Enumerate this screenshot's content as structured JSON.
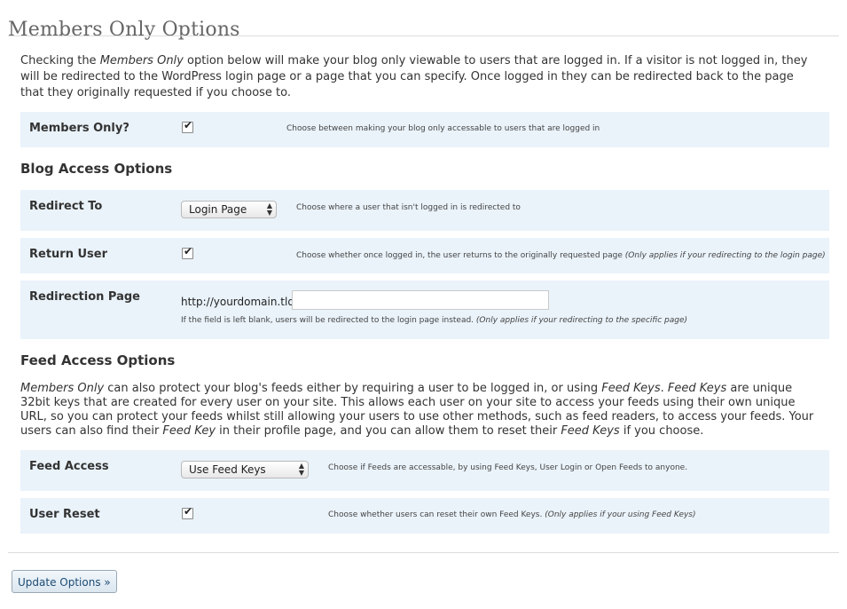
{
  "page": {
    "title": "Members Only Options",
    "intro_text_1": "Checking the ",
    "intro_em": "Members Only",
    "intro_text_2": " option below will make your blog only viewable to users that are logged in. If a visitor is not logged in, they will be redirected to the WordPress login page or a page that you can specify. Once logged in they can be redirected back to the page that they originally requested if you choose to."
  },
  "members_only": {
    "label": "Members Only?",
    "checked": true,
    "desc": "Choose between making your blog only accessable to users that are logged in"
  },
  "blog_access": {
    "heading": "Blog Access Options",
    "redirect_to": {
      "label": "Redirect To",
      "selected": "Login Page",
      "desc": "Choose where a user that isn't logged in is redirected to"
    },
    "return_user": {
      "label": "Return User",
      "checked": true,
      "desc": "Choose whether once logged in, the user returns to the originally requested page ",
      "note": "(Only applies if your redirecting to the login page)"
    },
    "redirection_page": {
      "label": "Redirection Page",
      "prefix": "http://yourdomain.tld/",
      "value": "",
      "desc": "If the field is left blank, users will be redirected to the login page instead. ",
      "note": "(Only applies if your redirecting to the specific page)"
    }
  },
  "feed_access": {
    "heading": "Feed Access Options",
    "text_em1": "Members Only",
    "text_1": " can also protect your blog's feeds either by requiring a user to be logged in, or using ",
    "text_em2": "Feed Keys",
    "text_2": ". ",
    "text_em3": "Feed Keys",
    "text_3": " are unique 32bit keys that are created for every user on your site. This allows each user on your site to access your feeds using their own unique URL, so you can protect your feeds whilst still allowing your users to use other methods, such as feed readers, to access your feeds. Your users can also find their ",
    "text_em4": "Feed Key",
    "text_4": " in their profile page, and you can allow them to reset their ",
    "text_em5": "Feed Keys",
    "text_5": " if you choose.",
    "feed_access_row": {
      "label": "Feed Access",
      "selected": "Use Feed Keys",
      "desc": "Choose if Feeds are accessable, by using Feed Keys, User Login or Open Feeds to anyone."
    },
    "user_reset": {
      "label": "User Reset",
      "checked": true,
      "desc": "Choose whether users can reset their own Feed Keys. ",
      "note": "(Only applies if your using Feed Keys)"
    }
  },
  "update_button": "Update Options »",
  "icons": {
    "checkmark": "✔",
    "select_up": "▲",
    "select_down": "▼"
  }
}
